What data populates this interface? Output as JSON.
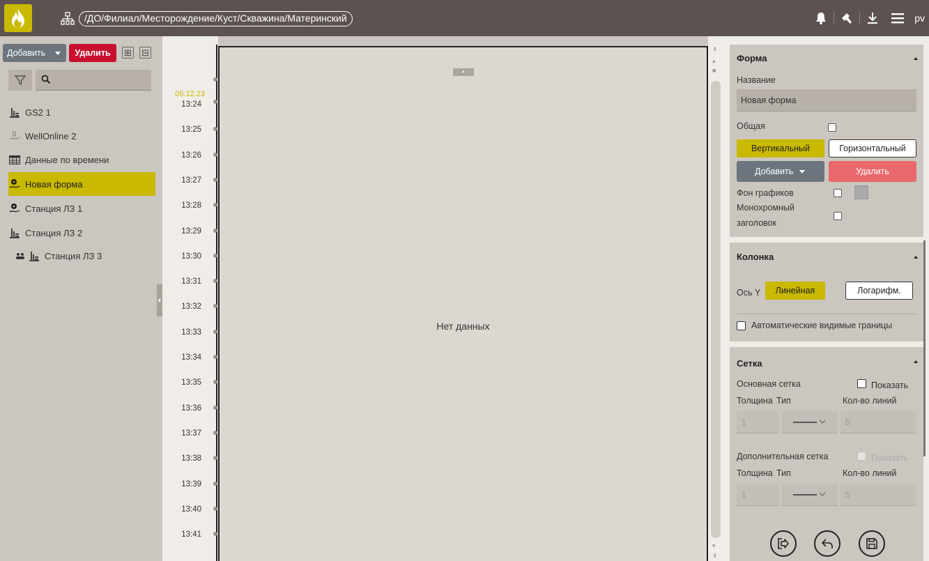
{
  "header": {
    "breadcrumb": "/ДО/Филиал/Месторождение/Куст/Скважина/Материнский",
    "user": "pv"
  },
  "colors": {
    "accent": "#c9b900",
    "danger": "#c8102e",
    "topbar": "#5c5350"
  },
  "left": {
    "add_label": "Добавить",
    "delete_label": "Удалить",
    "expand_glyph": "⊞",
    "collapse_glyph": "⊟",
    "tree": [
      {
        "label": "GS2 1",
        "icon": "pump-icon"
      },
      {
        "label": "WellOnline 2",
        "icon": "well-icon"
      },
      {
        "label": "Данные по времени",
        "icon": "table-icon"
      },
      {
        "label": "Новая форма",
        "icon": "gauge-icon",
        "active": true
      },
      {
        "label": "Станция ЛЗ 1",
        "icon": "gauge-icon"
      },
      {
        "label": "Станция ЛЗ 2",
        "icon": "pump-icon"
      },
      {
        "label": "Станция ЛЗ 3",
        "icon": "pump-icon"
      }
    ]
  },
  "timeaxis": {
    "date": "05.12.23",
    "ticks": [
      "13:24",
      "13:25",
      "13:26",
      "13:27",
      "13:28",
      "13:29",
      "13:30",
      "13:31",
      "13:32",
      "13:33",
      "13:34",
      "13:35",
      "13:36",
      "13:37",
      "13:38",
      "13:39",
      "13:40",
      "13:41"
    ]
  },
  "chart": {
    "no_data": "Нет данных"
  },
  "panel": {
    "forma": {
      "title": "Форма",
      "name_label": "Название",
      "name_value": "Новая форма",
      "common_label": "Общая",
      "vertical_label": "Вертикальный",
      "horizontal_label": "Горизонтальный",
      "add_label": "Добавить",
      "delete_label": "Удалить",
      "bg_label": "Фон графиков",
      "mono_label_1": "Монохромный",
      "mono_label_2": "заголовок"
    },
    "column": {
      "title": "Колонка",
      "axis_label": "Ось Y",
      "linear_label": "Линейная",
      "log_label": "Логарифм.",
      "auto_bounds_label": "Автоматические видимые границы"
    },
    "grid": {
      "title": "Сетка",
      "main_label": "Основная сетка",
      "show_label": "Показать",
      "thickness_label": "Толщина",
      "type_label": "Тип",
      "lines_label": "Кол-во линий",
      "main_thickness": "1",
      "main_lines": "5",
      "extra_label": "Дополнительная сетка",
      "extra_show_label": "Показать",
      "extra_thickness": "1",
      "extra_lines": "5"
    }
  }
}
